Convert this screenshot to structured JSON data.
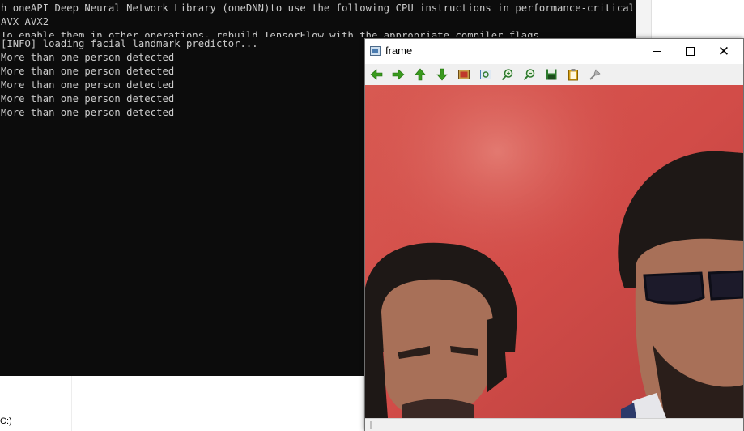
{
  "console": {
    "lines": [
      "h oneAPI Deep Neural Network Library (oneDNN)to use the following CPU instructions in performance-critical operations:",
      "AVX AVX2",
      "To enable them in other operations, rebuild TensorFlow with the appropriate compiler flags.",
      "[INFO] loading facial landmark predictor...",
      "More than one person detected",
      "More than one person detected",
      "More than one person detected",
      "More than one person detected",
      "More than one person detected"
    ]
  },
  "background": {
    "drive_label": "C:)"
  },
  "frame_window": {
    "title": "frame",
    "minimize_glyph": "—",
    "maximize_glyph": "☐",
    "close_glyph": "✕",
    "toolbar": [
      {
        "name": "pan-left-icon",
        "color": "#3a9a1e"
      },
      {
        "name": "pan-right-icon",
        "color": "#3a9a1e"
      },
      {
        "name": "pan-up-icon",
        "color": "#3a9a1e"
      },
      {
        "name": "pan-down-icon",
        "color": "#3a9a1e"
      },
      {
        "name": "zoom-original-icon",
        "color": "#c0392b"
      },
      {
        "name": "zoom-fit-icon",
        "color": "#4a7fb5"
      },
      {
        "name": "zoom-in-icon",
        "color": "#2d7a2d"
      },
      {
        "name": "zoom-out-icon",
        "color": "#2d7a2d"
      },
      {
        "name": "save-icon",
        "color": "#2d7a2d"
      },
      {
        "name": "copy-to-clipboard-icon",
        "color": "#d4a017"
      },
      {
        "name": "properties-icon",
        "color": "#8a8a8a"
      }
    ],
    "image_description_colors": {
      "wall": "#d14a46",
      "hair": "#1e1816",
      "skin": "#a87058"
    }
  }
}
